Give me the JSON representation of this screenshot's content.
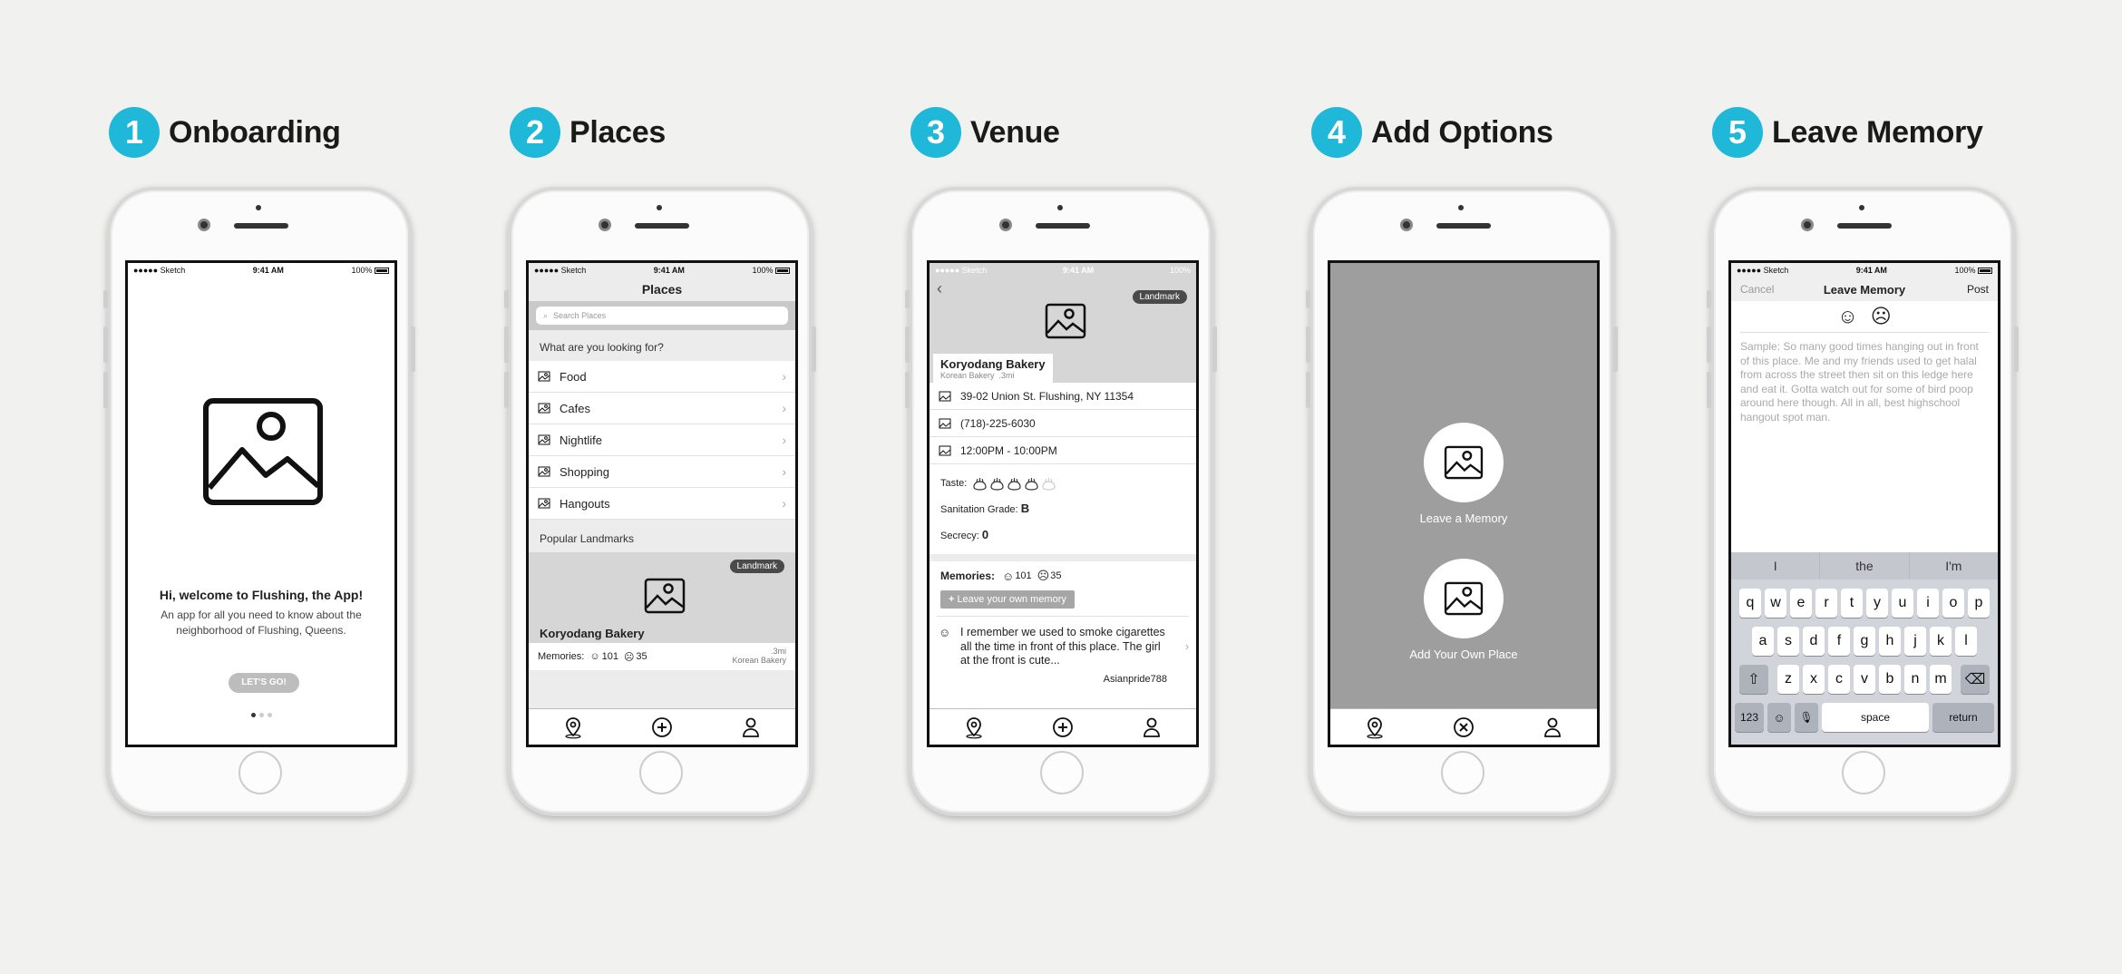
{
  "steps": [
    {
      "num": "1",
      "title": "Onboarding"
    },
    {
      "num": "2",
      "title": "Places"
    },
    {
      "num": "3",
      "title": "Venue"
    },
    {
      "num": "4",
      "title": "Add Options"
    },
    {
      "num": "5",
      "title": "Leave Memory"
    }
  ],
  "status": {
    "carrier": "●●●●● Sketch",
    "time": "9:41 AM",
    "battery": "100%"
  },
  "onboarding": {
    "heading": "Hi, welcome to Flushing, the App!",
    "body": "An app for all you need to know about the neighborhood of Flushing, Queens.",
    "button": "LET'S GO!"
  },
  "places": {
    "title": "Places",
    "search_placeholder": "Search Places",
    "prompt": "What are you looking for?",
    "categories": [
      "Food",
      "Cafes",
      "Nightlife",
      "Shopping",
      "Hangouts"
    ],
    "popular_label": "Popular Landmarks",
    "card": {
      "badge": "Landmark",
      "name": "Koryodang Bakery",
      "memories_label": "Memories:",
      "happy_count": "101",
      "sad_count": "35",
      "distance": ".3mi",
      "category": "Korean Bakery"
    }
  },
  "venue": {
    "badge": "Landmark",
    "name": "Koryodang Bakery",
    "sub": "Korean Bakery  .3mi",
    "address": "39-02 Union St. Flushing, NY 11354",
    "phone": "(718)-225-6030",
    "hours": "12:00PM - 10:00PM",
    "taste_label": "Taste:",
    "taste_rating": 4,
    "taste_max": 5,
    "sanitation_label": "Sanitation Grade:",
    "sanitation_grade": "B",
    "secrecy_label": "Secrecy:",
    "secrecy_value": "0",
    "memories_label": "Memories:",
    "happy_count": "101",
    "sad_count": "35",
    "leave_button": "Leave your own memory",
    "memory_text": "I remember we used to smoke cigarettes all the time in front of this place. The girl at the front is cute...",
    "memory_user": "Asianpride788"
  },
  "add_options": {
    "memory_label": "Leave a Memory",
    "place_label": "Add Your Own Place"
  },
  "leave_memory": {
    "cancel": "Cancel",
    "title": "Leave Memory",
    "post": "Post",
    "placeholder": "Sample: So many good times hanging out in front of this place. Me and my friends used to get halal from across the street then sit on this ledge here and eat it. Gotta watch out for some of bird poop around here though. All in all, best highschool hangout spot man.",
    "suggestions": [
      "I",
      "the",
      "I'm"
    ],
    "keys_row1": [
      "q",
      "w",
      "e",
      "r",
      "t",
      "y",
      "u",
      "i",
      "o",
      "p"
    ],
    "keys_row2": [
      "a",
      "s",
      "d",
      "f",
      "g",
      "h",
      "j",
      "k",
      "l"
    ],
    "keys_row3": [
      "z",
      "x",
      "c",
      "v",
      "b",
      "n",
      "m"
    ],
    "key_numbers": "123",
    "key_space": "space",
    "key_return": "return"
  }
}
